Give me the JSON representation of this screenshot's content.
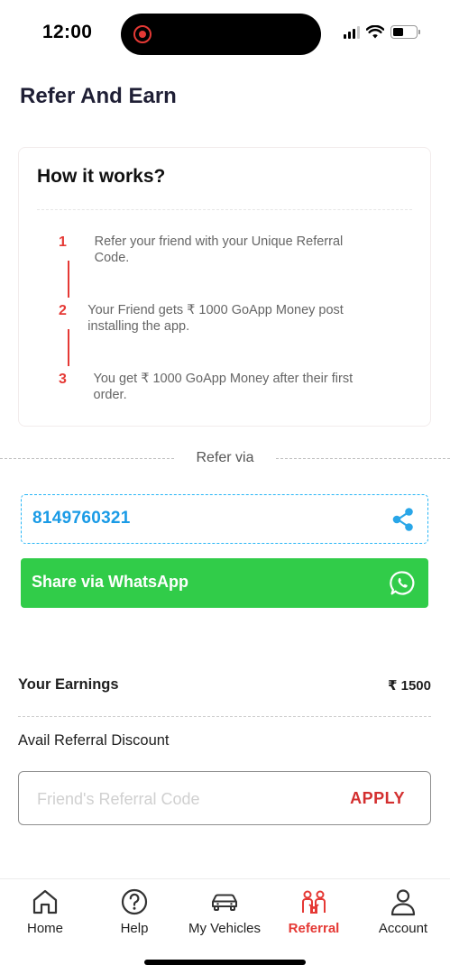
{
  "status_bar": {
    "time": "12:00"
  },
  "page": {
    "title": "Refer And Earn"
  },
  "how_it_works": {
    "title": "How it works?",
    "steps": [
      {
        "number": "1",
        "text": "Refer your friend with your Unique Referral Code."
      },
      {
        "number": "2",
        "text": "Your Friend gets ₹ 1000 GoApp Money post installing the app."
      },
      {
        "number": "3",
        "text": "You get ₹ 1000 GoApp Money after their first order."
      }
    ]
  },
  "refer_via": {
    "label": "Refer via",
    "referral_code": "8149760321",
    "whatsapp_label": "Share via WhatsApp"
  },
  "earnings": {
    "label": "Your Earnings",
    "value": "₹ 1500"
  },
  "discount": {
    "label": "Avail Referral Discount",
    "input_placeholder": "Friend's Referral Code",
    "input_value": "",
    "apply_label": "APPLY"
  },
  "bottom_nav": {
    "active": "Referral",
    "items": [
      {
        "label": "Home",
        "icon": "home-icon"
      },
      {
        "label": "Help",
        "icon": "help-icon"
      },
      {
        "label": "My Vehicles",
        "icon": "car-icon"
      },
      {
        "label": "Referral",
        "icon": "referral-icon"
      },
      {
        "label": "Account",
        "icon": "account-icon"
      }
    ]
  },
  "colors": {
    "accent_red": "#e53935",
    "whatsapp_green": "#31cc49",
    "code_blue": "#1a9be6"
  }
}
